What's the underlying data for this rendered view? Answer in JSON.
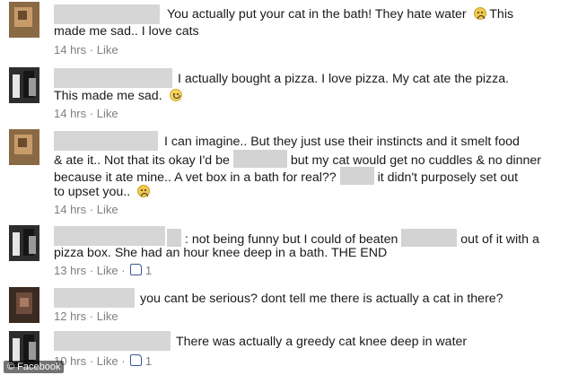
{
  "comments": [
    {
      "line1": "You actually put your cat in the bath! They hate water",
      "line1_suffix": "This",
      "line2": "made me sad.. I love cats",
      "time": "14 hrs",
      "like": "Like"
    },
    {
      "line1": "I actually bought a pizza. I love pizza. My cat ate the pizza.",
      "line2": "This made me sad.",
      "time": "14 hrs",
      "like": "Like"
    },
    {
      "line1": "I can imagine.. But they just use their instincts and it smelt food",
      "line2": "& ate it.. Not that its okay I'd be",
      "line2_after": "but my cat would get no cuddles & no dinner",
      "line3": "because it ate mine.. A vet box in a bath for real??",
      "line3_after": "it didn't purposely set out",
      "line4": "to upset you..",
      "time": "14 hrs",
      "like": "Like"
    },
    {
      "line1": ": not being funny but I could of beaten",
      "line1_after": "out of it with a",
      "line2": "pizza box. She had an hour knee deep in a bath. THE END",
      "time": "13 hrs",
      "like": "Like",
      "likes": "1"
    },
    {
      "line1": "you cant be serious? dont tell me there is actually a cat in there?",
      "time": "12 hrs",
      "like": "Like"
    },
    {
      "line1": "There was actually a greedy cat knee deep in water",
      "time": "10 hrs",
      "like": "Like",
      "likes": "1"
    }
  ],
  "separator": "·",
  "watermark": "© Facebook",
  "icons": {
    "sad": "sad-emoticon-icon",
    "smile": "smile-emoticon-icon",
    "like": "thumbs-up-icon"
  }
}
